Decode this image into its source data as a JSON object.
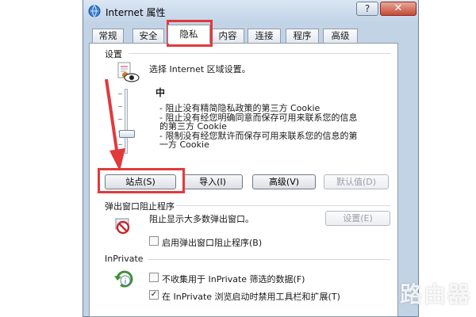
{
  "window": {
    "title": "Internet 属性",
    "help_label": "?",
    "close_label": "✕",
    "icon": "internet-options-icon"
  },
  "tabs": [
    {
      "label": "常规"
    },
    {
      "label": "安全"
    },
    {
      "label": "隐私"
    },
    {
      "label": "内容"
    },
    {
      "label": "连接"
    },
    {
      "label": "程序"
    },
    {
      "label": "高级"
    }
  ],
  "active_tab": "隐私",
  "settings": {
    "label": "设置",
    "instruction": "选择 Internet 区域设置。",
    "level": "中",
    "descriptions": [
      "- 阻止没有精简隐私政策的第三方 Cookie",
      "- 阻止没有经您明确同意而保存可用来联系您的信息",
      "的第三方 Cookie",
      "- 限制没有经您默许而保存可用来联系您的信息的第",
      "一方 Cookie"
    ],
    "buttons": {
      "sites": "站点(S)",
      "import": "导入(I)",
      "advanced": "高级(V)",
      "default": "默认值(D)"
    }
  },
  "popup_blocker": {
    "label": "弹出窗口阻止程序",
    "description": "阻止显示大多数弹出窗口。",
    "settings_button": "设置(E)",
    "enable_checkbox": "启用弹出窗口阻止程序(B)",
    "enable_checked": false
  },
  "inprivate": {
    "label": "InPrivate",
    "option1": "不收集用于 InPrivate 筛选的数据(F)",
    "option1_checked": false,
    "option2": "在 InPrivate 浏览启动时禁用工具栏和扩展(T)",
    "option2_checked": true,
    "check_mark": "✓"
  },
  "watermark": {
    "text": "路由器",
    "icon": "router-logo-icon"
  },
  "colors": {
    "highlight": "#e2393b",
    "frame": "#c3d3e6"
  }
}
